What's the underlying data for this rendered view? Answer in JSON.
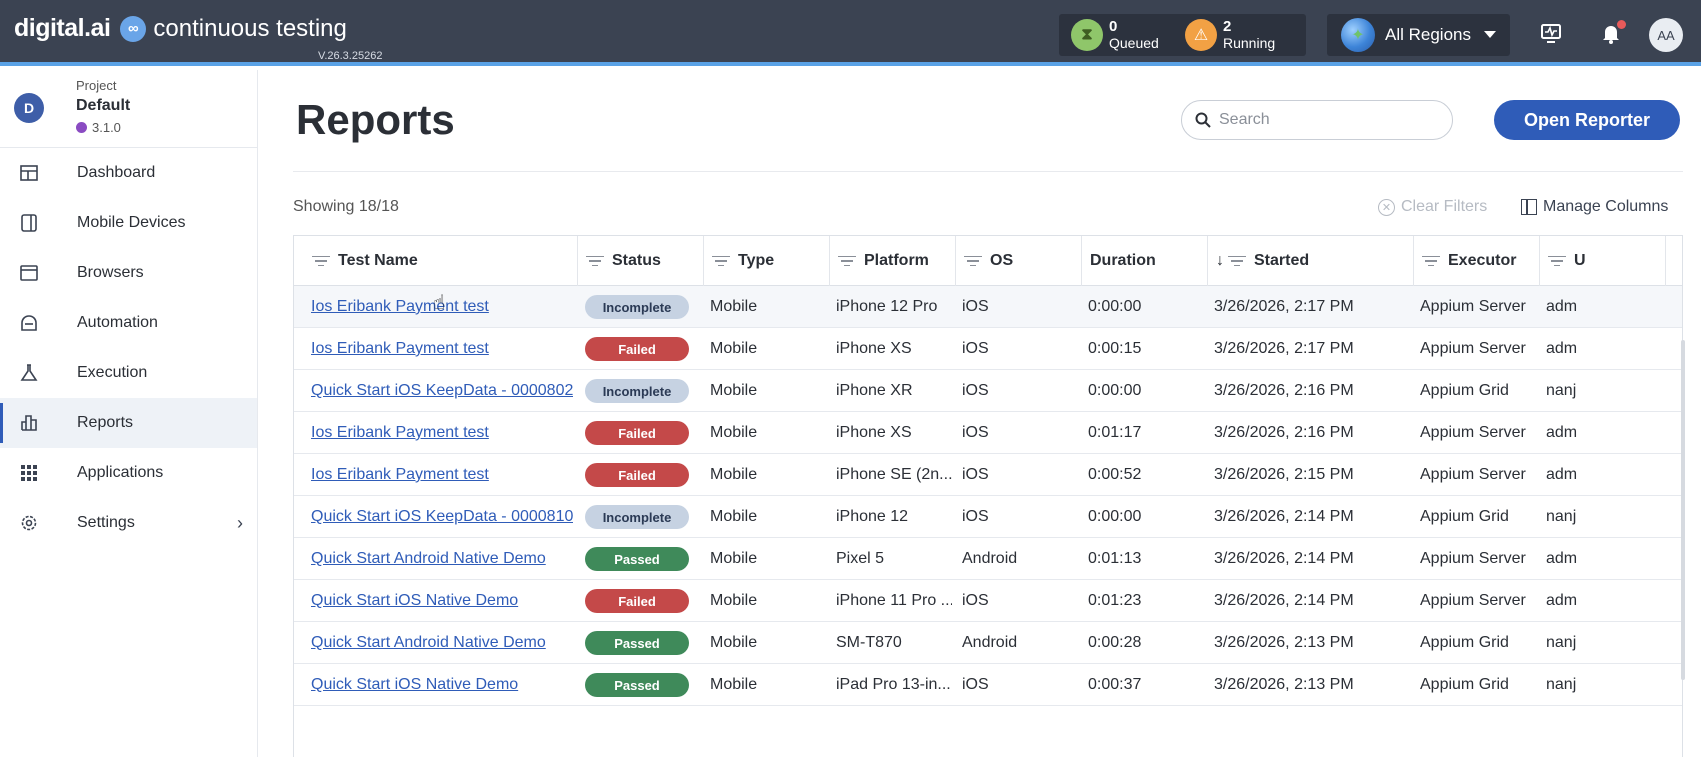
{
  "topbar": {
    "brand": "digital.ai",
    "product": "continuous testing",
    "version": "V.26.3.25262",
    "queued": {
      "count": "0",
      "label": "Queued"
    },
    "running": {
      "count": "2",
      "label": "Running"
    },
    "region": "All Regions",
    "user_initials": "AA"
  },
  "sidebar": {
    "project_label": "Project",
    "project_name": "Default",
    "project_avatar": "D",
    "project_version": "3.1.0",
    "items": [
      {
        "label": "Dashboard",
        "icon": "dashboard-icon"
      },
      {
        "label": "Mobile Devices",
        "icon": "mobile-icon"
      },
      {
        "label": "Browsers",
        "icon": "browser-icon"
      },
      {
        "label": "Automation",
        "icon": "robot-icon"
      },
      {
        "label": "Execution",
        "icon": "flask-icon"
      },
      {
        "label": "Reports",
        "icon": "reports-icon",
        "active": true
      },
      {
        "label": "Applications",
        "icon": "grid-icon"
      },
      {
        "label": "Settings",
        "icon": "gear-icon"
      }
    ]
  },
  "main": {
    "title": "Reports",
    "search_placeholder": "Search",
    "open_reporter": "Open Reporter",
    "showing": "Showing 18/18",
    "clear_filters": "Clear Filters",
    "manage_columns": "Manage Columns"
  },
  "table": {
    "columns": [
      "Test Name",
      "Status",
      "Type",
      "Platform",
      "OS",
      "Duration",
      "Started",
      "Executor",
      "U"
    ],
    "rows": [
      {
        "name": "Ios Eribank Payment test",
        "status": "Incomplete",
        "type": "Mobile",
        "platform": "iPhone 12 Pro",
        "os": "iOS",
        "duration": "0:00:00",
        "started": "3/26/2026, 2:17 PM",
        "executor": "Appium Server",
        "user": "adm"
      },
      {
        "name": "Ios Eribank Payment test",
        "status": "Failed",
        "type": "Mobile",
        "platform": "iPhone XS",
        "os": "iOS",
        "duration": "0:00:15",
        "started": "3/26/2026, 2:17 PM",
        "executor": "Appium Server",
        "user": "adm"
      },
      {
        "name": "Quick Start iOS KeepData - 0000802...",
        "status": "Incomplete",
        "type": "Mobile",
        "platform": "iPhone XR",
        "os": "iOS",
        "duration": "0:00:00",
        "started": "3/26/2026, 2:16 PM",
        "executor": "Appium Grid",
        "user": "nanj"
      },
      {
        "name": "Ios Eribank Payment test",
        "status": "Failed",
        "type": "Mobile",
        "platform": "iPhone XS",
        "os": "iOS",
        "duration": "0:01:17",
        "started": "3/26/2026, 2:16 PM",
        "executor": "Appium Server",
        "user": "adm"
      },
      {
        "name": "Ios Eribank Payment test",
        "status": "Failed",
        "type": "Mobile",
        "platform": "iPhone SE (2n...",
        "os": "iOS",
        "duration": "0:00:52",
        "started": "3/26/2026, 2:15 PM",
        "executor": "Appium Server",
        "user": "adm"
      },
      {
        "name": "Quick Start iOS KeepData - 0000810...",
        "status": "Incomplete",
        "type": "Mobile",
        "platform": "iPhone 12",
        "os": "iOS",
        "duration": "0:00:00",
        "started": "3/26/2026, 2:14 PM",
        "executor": "Appium Grid",
        "user": "nanj"
      },
      {
        "name": "Quick Start Android Native Demo",
        "status": "Passed",
        "type": "Mobile",
        "platform": "Pixel 5",
        "os": "Android",
        "duration": "0:01:13",
        "started": "3/26/2026, 2:14 PM",
        "executor": "Appium Server",
        "user": "adm"
      },
      {
        "name": "Quick Start iOS Native Demo",
        "status": "Failed",
        "type": "Mobile",
        "platform": "iPhone 11 Pro ...",
        "os": "iOS",
        "duration": "0:01:23",
        "started": "3/26/2026, 2:14 PM",
        "executor": "Appium Server",
        "user": "adm"
      },
      {
        "name": "Quick Start Android Native Demo",
        "status": "Passed",
        "type": "Mobile",
        "platform": "SM-T870",
        "os": "Android",
        "duration": "0:00:28",
        "started": "3/26/2026, 2:13 PM",
        "executor": "Appium Grid",
        "user": "nanj"
      },
      {
        "name": "Quick Start iOS Native Demo",
        "status": "Passed",
        "type": "Mobile",
        "platform": "iPad Pro 13-in...",
        "os": "iOS",
        "duration": "0:00:37",
        "started": "3/26/2026, 2:13 PM",
        "executor": "Appium Grid",
        "user": "nanj"
      }
    ]
  }
}
